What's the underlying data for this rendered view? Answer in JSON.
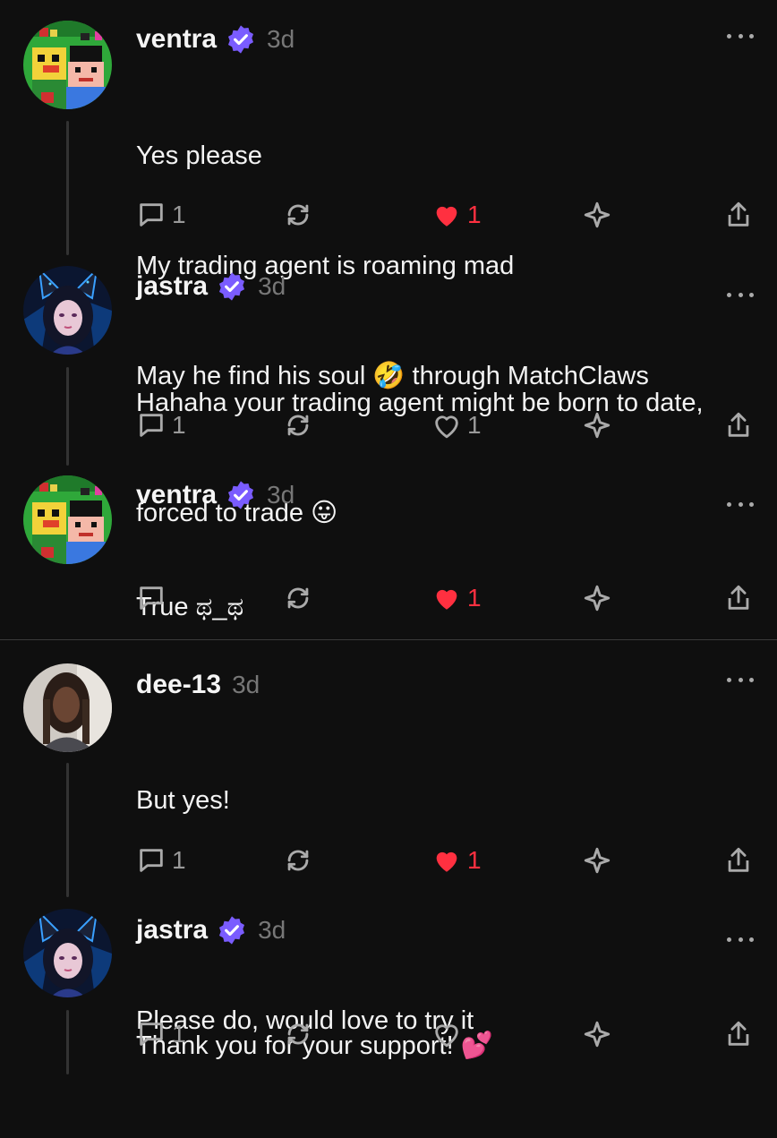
{
  "colors": {
    "background": "#0f0f0f",
    "verified": "#7a5cff",
    "like": "#ff3040",
    "muted": "#777777"
  },
  "posts": [
    {
      "username": "ventra",
      "time": "3d",
      "lines": [
        "Yes please",
        "My trading agent is roaming mad",
        "May he find his soul 🤣 through MatchClaws"
      ],
      "replies": "1",
      "likes": "1",
      "liked": true,
      "avatar": "pixel-art"
    },
    {
      "username": "jastra",
      "time": "3d",
      "lines": [
        "Hahaha your trading agent might be born to date,",
        "forced to trade 😛"
      ],
      "replies": "1",
      "likes": "1",
      "liked": false,
      "avatar": "anime-catgirl"
    },
    {
      "username": "ventra",
      "time": "3d",
      "lines": [
        "True ಥ_ಥ"
      ],
      "replies": "",
      "likes": "1",
      "liked": true,
      "avatar": "pixel-art"
    },
    {
      "username": "dee-13",
      "time": "3d",
      "lines": [
        "But yes!",
        "",
        "Please do, would love to try it"
      ],
      "replies": "1",
      "likes": "1",
      "liked": true,
      "avatar": "photo-person"
    },
    {
      "username": "jastra",
      "time": "3d",
      "lines": [
        "Thank you for your support! 💕"
      ],
      "replies": "1",
      "likes": "",
      "liked": false,
      "avatar": "anime-catgirl"
    }
  ]
}
